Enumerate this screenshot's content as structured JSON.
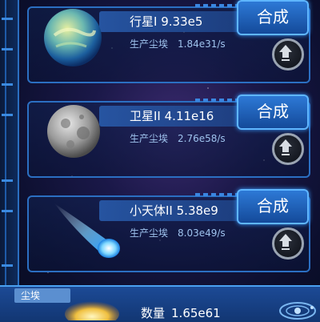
{
  "cards": [
    {
      "name": "行星I",
      "count": "9.33e5",
      "prod_label": "生产尘埃",
      "prod_rate": "1.84e31/s",
      "synth_label": "合成"
    },
    {
      "name": "卫星II",
      "count": "4.11e16",
      "prod_label": "生产尘埃",
      "prod_rate": "2.76e58/s",
      "synth_label": "合成"
    },
    {
      "name": "小天体II",
      "count": "5.38e9",
      "prod_label": "生产尘埃",
      "prod_rate": "8.03e49/s",
      "synth_label": "合成"
    }
  ],
  "bottom": {
    "dust_label": "尘埃",
    "qty_label": "数量",
    "qty_value": "1.65e61"
  },
  "icons": [
    "planet-icon",
    "moon-icon",
    "comet-icon",
    "upgrade-arrow-icon",
    "dust-icon",
    "orbit-icon"
  ],
  "colors": {
    "accent": "#2b6fc2",
    "button": "#2d79d6",
    "text_secondary": "#9fc3ee"
  }
}
